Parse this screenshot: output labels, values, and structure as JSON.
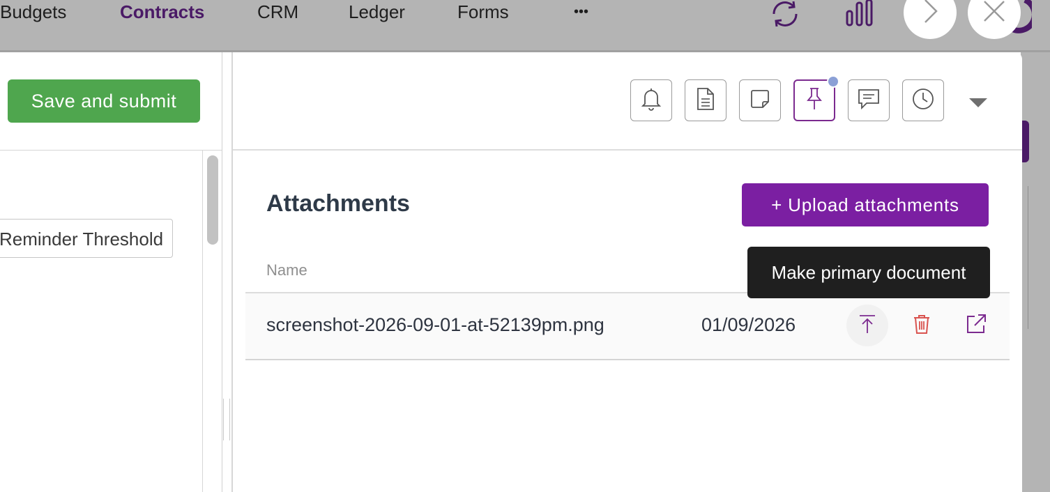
{
  "nav": {
    "items": [
      {
        "label": "Budgets",
        "active": false
      },
      {
        "label": "Contracts",
        "active": true
      },
      {
        "label": "CRM",
        "active": false
      },
      {
        "label": "Ledger",
        "active": false
      },
      {
        "label": "Forms",
        "active": false
      }
    ],
    "more_label": "•••",
    "icons": [
      "refresh-icon",
      "bar-chart-icon",
      "chevron-right-icon",
      "close-icon"
    ]
  },
  "left_pane": {
    "save_button_label": "Save and submit",
    "reminder_input_value": "Reminder Threshold"
  },
  "panel": {
    "toolbar_icons": [
      "bell-icon",
      "document-icon",
      "note-icon",
      "pin-icon",
      "comment-icon",
      "clock-icon"
    ],
    "active_toolbar_icon": "pin-icon",
    "title": "Attachments",
    "upload_button_label": "+ Upload attachments",
    "column_header": "Name",
    "attachments": [
      {
        "name": "screenshot-2026-09-01-at-52139pm.png",
        "date": "01/09/2026",
        "actions": [
          "make-primary-icon",
          "trash-icon",
          "external-link-icon"
        ]
      }
    ],
    "tooltip": "Make primary document"
  },
  "colors": {
    "brand_purple": "#7b1fa2",
    "save_green": "#4fa64e",
    "delete_red": "#d9534f",
    "overlay_grey": "#b4b4b4"
  }
}
